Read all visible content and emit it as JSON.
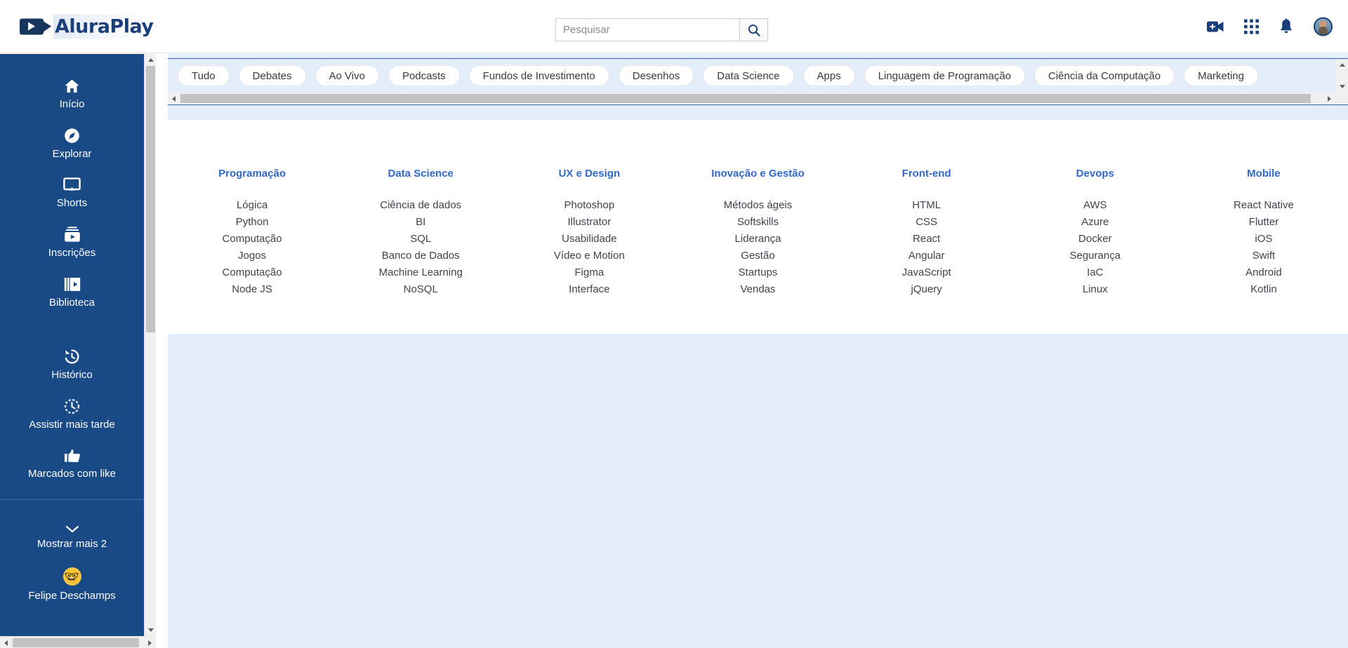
{
  "brand": {
    "name": "AluraPlay",
    "logo_icon": "video-camera-icon",
    "primary_color": "#1b4079",
    "sidebar_color": "#194a86",
    "accent_color": "#3268c8"
  },
  "search": {
    "placeholder": "Pesquisar",
    "value": "",
    "button_icon": "search-icon"
  },
  "header": {
    "actions": [
      {
        "name": "create-video-icon",
        "label": "Criar"
      },
      {
        "name": "apps-grid-icon",
        "label": "Apps"
      },
      {
        "name": "notifications-bell-icon",
        "label": "Notificações"
      },
      {
        "name": "user-avatar",
        "label": "Conta"
      }
    ]
  },
  "sidebar": {
    "primary_items": [
      {
        "label": "Início",
        "icon": "home-icon"
      },
      {
        "label": "Explorar",
        "icon": "compass-icon"
      },
      {
        "label": "Shorts",
        "icon": "shorts-screen-icon"
      },
      {
        "label": "Inscrições",
        "icon": "subscriptions-icon"
      },
      {
        "label": "Biblioteca",
        "icon": "library-icon"
      }
    ],
    "secondary_items": [
      {
        "label": "Histórico",
        "icon": "history-clock-icon"
      },
      {
        "label": "Assistir mais tarde",
        "icon": "watch-later-icon"
      },
      {
        "label": "Marcados com like",
        "icon": "thumbs-up-icon"
      }
    ],
    "show_more": {
      "label": "Mostrar mais 2",
      "icon": "chevron-down-icon"
    },
    "profile": {
      "label": "Felipe Deschamps",
      "icon": "profile-emoji-avatar",
      "emoji": "🤓"
    }
  },
  "chips": [
    "Tudo",
    "Debates",
    "Ao Vivo",
    "Podcasts",
    "Fundos de Investimento",
    "Desenhos",
    "Data Science",
    "Apps",
    "Linguagem de Programação",
    "Ciência da Computação",
    "Marketing"
  ],
  "categories": [
    {
      "title": "Programação",
      "items": [
        "Lógica",
        "Python",
        "Computação",
        "Jogos",
        "Computação",
        "Node JS"
      ]
    },
    {
      "title": "Data Science",
      "items": [
        "Ciência de dados",
        "BI",
        "SQL",
        "Banco de Dados",
        "Machine Learning",
        "NoSQL"
      ]
    },
    {
      "title": "UX e Design",
      "items": [
        "Photoshop",
        "Illustrator",
        "Usabilidade",
        "Vídeo e Motion",
        "Figma",
        "Interface"
      ]
    },
    {
      "title": "Inovação e Gestão",
      "items": [
        "Métodos ágeis",
        "Softskills",
        "Liderança",
        "Gestão",
        "Startups",
        "Vendas"
      ]
    },
    {
      "title": "Front-end",
      "items": [
        "HTML",
        "CSS",
        "React",
        "Angular",
        "JavaScript",
        "jQuery"
      ]
    },
    {
      "title": "Devops",
      "items": [
        "AWS",
        "Azure",
        "Docker",
        "Segurança",
        "IaC",
        "Linux"
      ]
    },
    {
      "title": "Mobile",
      "items": [
        "React Native",
        "Flutter",
        "iOS",
        "Swift",
        "Android",
        "Kotlin"
      ]
    }
  ]
}
